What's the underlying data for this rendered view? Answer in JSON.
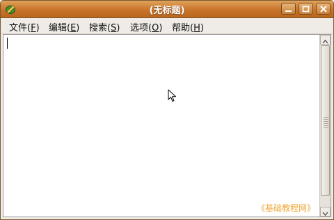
{
  "window": {
    "title": "(无标题)",
    "controls": [
      "minimize-icon",
      "maximize-icon",
      "close-icon"
    ]
  },
  "menubar": {
    "items": [
      {
        "pre": "文件(",
        "key": "F",
        "post": ")"
      },
      {
        "pre": "编辑(",
        "key": "E",
        "post": ")"
      },
      {
        "pre": "搜索(",
        "key": "S",
        "post": ")"
      },
      {
        "pre": "选项(",
        "key": "O",
        "post": ")"
      },
      {
        "pre": "帮助(",
        "key": "H",
        "post": ")"
      }
    ]
  },
  "editor": {
    "content": "",
    "watermark": "《基础教程网》"
  },
  "colors": {
    "titlebar": "#c9742a",
    "menubar": "#efebe7",
    "watermark": "#f0a838"
  }
}
